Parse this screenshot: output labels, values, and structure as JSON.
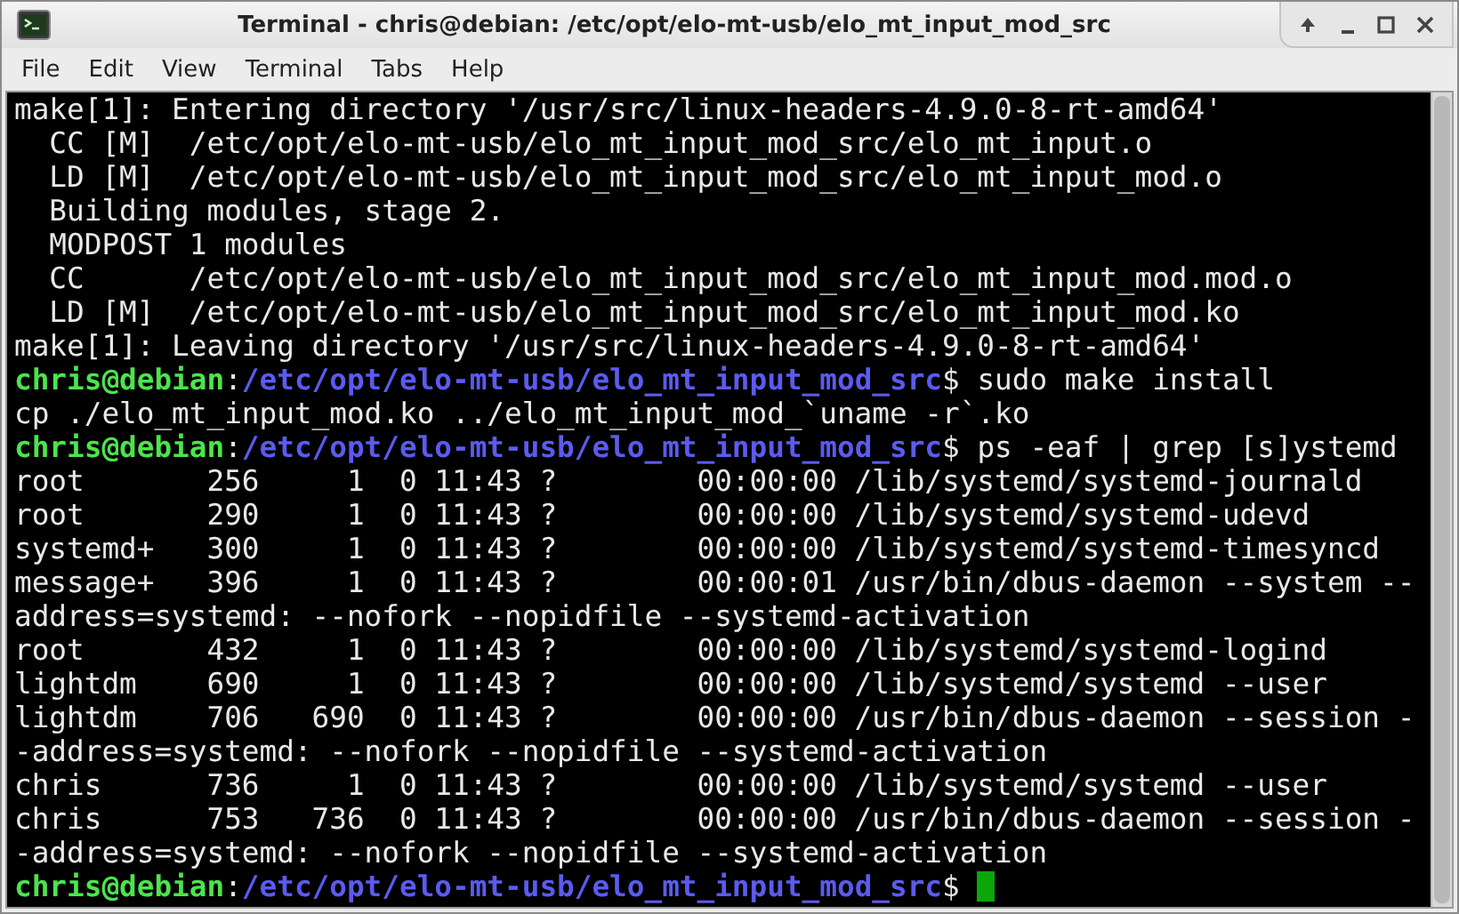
{
  "window": {
    "title": "Terminal - chris@debian: /etc/opt/elo-mt-usb/elo_mt_input_mod_src"
  },
  "menu": [
    "File",
    "Edit",
    "View",
    "Terminal",
    "Tabs",
    "Help"
  ],
  "terminal": {
    "lines": [
      {
        "kind": "output",
        "text": "make[1]: Entering directory '/usr/src/linux-headers-4.9.0-8-rt-amd64'"
      },
      {
        "kind": "output",
        "text": "  CC [M]  /etc/opt/elo-mt-usb/elo_mt_input_mod_src/elo_mt_input.o"
      },
      {
        "kind": "output",
        "text": "  LD [M]  /etc/opt/elo-mt-usb/elo_mt_input_mod_src/elo_mt_input_mod.o"
      },
      {
        "kind": "output",
        "text": "  Building modules, stage 2."
      },
      {
        "kind": "output",
        "text": "  MODPOST 1 modules"
      },
      {
        "kind": "output",
        "text": "  CC      /etc/opt/elo-mt-usb/elo_mt_input_mod_src/elo_mt_input_mod.mod.o"
      },
      {
        "kind": "output",
        "text": "  LD [M]  /etc/opt/elo-mt-usb/elo_mt_input_mod_src/elo_mt_input_mod.ko"
      },
      {
        "kind": "output",
        "text": "make[1]: Leaving directory '/usr/src/linux-headers-4.9.0-8-rt-amd64'"
      },
      {
        "kind": "prompt",
        "user": "chris@debian",
        "separator": ":",
        "path": "/etc/opt/elo-mt-usb/elo_mt_input_mod_src",
        "command": "$ sudo make install"
      },
      {
        "kind": "output",
        "text": "cp ./elo_mt_input_mod.ko ../elo_mt_input_mod_`uname -r`.ko"
      },
      {
        "kind": "prompt",
        "user": "chris@debian",
        "separator": ":",
        "path": "/etc/opt/elo-mt-usb/elo_mt_input_mod_src",
        "command": "$ ps -eaf | grep [s]ystemd"
      },
      {
        "kind": "output",
        "text": "root       256     1  0 11:43 ?        00:00:00 /lib/systemd/systemd-journald"
      },
      {
        "kind": "output",
        "text": "root       290     1  0 11:43 ?        00:00:00 /lib/systemd/systemd-udevd"
      },
      {
        "kind": "output",
        "text": "systemd+   300     1  0 11:43 ?        00:00:00 /lib/systemd/systemd-timesyncd"
      },
      {
        "kind": "output",
        "text": "message+   396     1  0 11:43 ?        00:00:01 /usr/bin/dbus-daemon --system --"
      },
      {
        "kind": "output",
        "text": "address=systemd: --nofork --nopidfile --systemd-activation"
      },
      {
        "kind": "output",
        "text": "root       432     1  0 11:43 ?        00:00:00 /lib/systemd/systemd-logind"
      },
      {
        "kind": "output",
        "text": "lightdm    690     1  0 11:43 ?        00:00:00 /lib/systemd/systemd --user"
      },
      {
        "kind": "output",
        "text": "lightdm    706   690  0 11:43 ?        00:00:00 /usr/bin/dbus-daemon --session -"
      },
      {
        "kind": "output",
        "text": "-address=systemd: --nofork --nopidfile --systemd-activation"
      },
      {
        "kind": "output",
        "text": "chris      736     1  0 11:43 ?        00:00:00 /lib/systemd/systemd --user"
      },
      {
        "kind": "output",
        "text": "chris      753   736  0 11:43 ?        00:00:00 /usr/bin/dbus-daemon --session -"
      },
      {
        "kind": "output",
        "text": "-address=systemd: --nofork --nopidfile --systemd-activation"
      },
      {
        "kind": "prompt",
        "user": "chris@debian",
        "separator": ":",
        "path": "/etc/opt/elo-mt-usb/elo_mt_input_mod_src",
        "command": "$ ",
        "cursor": true
      }
    ]
  }
}
